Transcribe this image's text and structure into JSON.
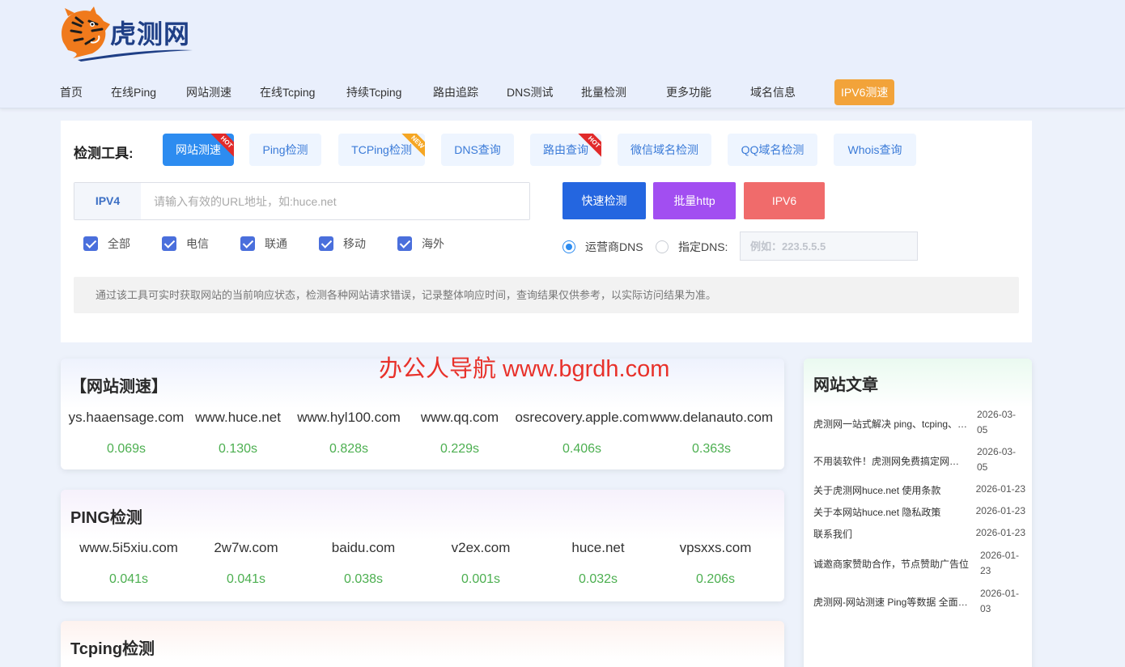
{
  "brand": {
    "name": "虎测网"
  },
  "nav": [
    "首页",
    "在线Ping",
    "网站测速",
    "在线Tcping",
    "持续Tcping",
    "路由追踪",
    "DNS测试",
    "批量检测",
    "更多功能",
    "域名信息",
    "IPV6测速"
  ],
  "tools": {
    "label": "检测工具:",
    "items": [
      {
        "label": "网站测速",
        "badge": "HOT"
      },
      {
        "label": "Ping检测",
        "badge": ""
      },
      {
        "label": "TCPing检测",
        "badge": "NEW"
      },
      {
        "label": "DNS查询",
        "badge": ""
      },
      {
        "label": "路由查询",
        "badge": "HOT"
      },
      {
        "label": "微信域名检测",
        "badge": ""
      },
      {
        "label": "QQ域名检测",
        "badge": ""
      },
      {
        "label": "Whois查询",
        "badge": ""
      }
    ]
  },
  "search": {
    "prefix": "IPV4",
    "placeholder": "请输入有效的URL地址，如:huce.net",
    "value": ""
  },
  "actions": {
    "quick": "快速检测",
    "batch": "批量http",
    "ipv6": "IPV6"
  },
  "lines": [
    "全部",
    "电信",
    "联通",
    "移动",
    "海外"
  ],
  "dns": {
    "carrier": "运营商DNS",
    "custom": "指定DNS:",
    "placeholder": "例如：223.5.5.5"
  },
  "notice": "通过该工具可实时获取网站的当前响应状态，检测各种网站请求错误，记录整体响应时间，查询结果仅供参考，以实际访问结果为准。",
  "watermark": "办公人导航  www.bgrdh.com",
  "speed": {
    "title": "【网站测速】",
    "results": [
      {
        "domain": "ys.haaensage.com",
        "time": "0.069s"
      },
      {
        "domain": "www.huce.net",
        "time": "0.130s"
      },
      {
        "domain": "www.hyl100.com",
        "time": "0.828s"
      },
      {
        "domain": "www.qq.com",
        "time": "0.229s"
      },
      {
        "domain": "osrecovery.apple.com",
        "time": "0.406s"
      },
      {
        "domain": "www.delanauto.com",
        "time": "0.363s"
      }
    ]
  },
  "ping": {
    "title": "PING检测",
    "results": [
      {
        "domain": "www.5i5xiu.com",
        "time": "0.041s"
      },
      {
        "domain": "2w7w.com",
        "time": "0.041s"
      },
      {
        "domain": "baidu.com",
        "time": "0.038s"
      },
      {
        "domain": "v2ex.com",
        "time": "0.001s"
      },
      {
        "domain": "huce.net",
        "time": "0.032s"
      },
      {
        "domain": "vpsxxs.com",
        "time": "0.206s"
      }
    ]
  },
  "tcping": {
    "title": "Tcping检测"
  },
  "articles": {
    "title": "网站文章",
    "items": [
      {
        "title": "虎测网一站式解决 ping、tcping、路由追踪",
        "date": "2026-03-05"
      },
      {
        "title": "不用装软件！虎测网免费搞定网站测速",
        "date": "2026-03-05"
      },
      {
        "title": "关于虎测网huce.net 使用条款",
        "date": "2026-01-23"
      },
      {
        "title": "关于本网站huce.net 隐私政策",
        "date": "2026-01-23"
      },
      {
        "title": "联系我们",
        "date": "2026-01-23"
      },
      {
        "title": "诚邀商家赞助合作，节点赞助广告位",
        "date": "2026-01-23"
      },
      {
        "title": "虎测网-网站测速 Ping等数据 全面检测",
        "date": "2026-01-03"
      }
    ]
  }
}
